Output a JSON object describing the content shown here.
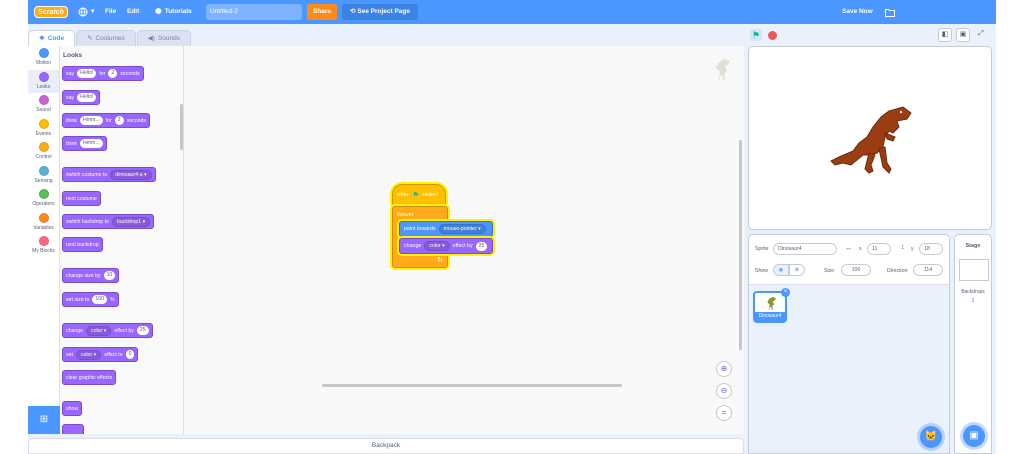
{
  "menu": {
    "logo": "Scratch",
    "language_icon": "globe-icon",
    "file": "File",
    "edit": "Edit",
    "tutorials": "Tutorials",
    "project_title": "Untitled-2",
    "share": "Share",
    "see_project_page": "See Project Page",
    "save_now": "Save Now",
    "folder_icon": "folder-icon"
  },
  "tabs": [
    {
      "label": "Code",
      "icon": "code-icon"
    },
    {
      "label": "Costumes",
      "icon": "brush-icon"
    },
    {
      "label": "Sounds",
      "icon": "speaker-icon"
    }
  ],
  "categories": [
    {
      "label": "Motion",
      "color": "#4c97ff"
    },
    {
      "label": "Looks",
      "color": "#9966ff"
    },
    {
      "label": "Sound",
      "color": "#cf63cf"
    },
    {
      "label": "Events",
      "color": "#ffbf00"
    },
    {
      "label": "Control",
      "color": "#ffab19"
    },
    {
      "label": "Sensing",
      "color": "#5cb1d6"
    },
    {
      "label": "Operators",
      "color": "#59c059"
    },
    {
      "label": "Variables",
      "color": "#ff8c1a"
    },
    {
      "label": "My Blocks",
      "color": "#ff6680"
    }
  ],
  "palette": {
    "title": "Looks",
    "say_for": {
      "a": "say",
      "v1": "Hello!",
      "b": "for",
      "v2": "2",
      "c": "seconds"
    },
    "say": {
      "a": "say",
      "v1": "Hello!"
    },
    "think_for": {
      "a": "think",
      "v1": "Hmm...",
      "b": "for",
      "v2": "2",
      "c": "seconds"
    },
    "think": {
      "a": "think",
      "v1": "Hmm..."
    },
    "switch_costume": {
      "a": "switch costume to",
      "v1": "dinosaur4-a"
    },
    "next_costume": "next costume",
    "switch_backdrop": {
      "a": "switch backdrop to",
      "v1": "backdrop1"
    },
    "next_backdrop": "next backdrop",
    "change_size": {
      "a": "change size by",
      "v1": "10"
    },
    "set_size": {
      "a": "set size to",
      "v1": "100",
      "b": "%"
    },
    "change_effect": {
      "a": "change",
      "v1": "color",
      "b": "effect by",
      "v2": "25"
    },
    "set_effect": {
      "a": "set",
      "v1": "color",
      "b": "effect to",
      "v2": "0"
    },
    "clear_effects": "clear graphic effects",
    "show": "show"
  },
  "script": {
    "when_flag": {
      "a": "when",
      "b": "clicked"
    },
    "forever": "forever",
    "point_towards": {
      "a": "point towards",
      "v1": "mouse-pointer"
    },
    "change_effect": {
      "a": "change",
      "v1": "color",
      "b": "effect by",
      "v2": "25"
    }
  },
  "backpack": "Backpack",
  "sprite_info": {
    "sprite_label": "Sprite",
    "sprite_name": "Dinosaur4",
    "x_label": "x",
    "x": "11",
    "y_label": "y",
    "y": "18",
    "show_label": "Show",
    "size_label": "Size",
    "size": "100",
    "direction_label": "Direction",
    "direction": "114"
  },
  "sprites": [
    {
      "name": "Dinosaur4"
    }
  ],
  "stage_pane": {
    "title": "Stage",
    "backdrops_label": "Backdrops",
    "backdrops_count": "1"
  }
}
